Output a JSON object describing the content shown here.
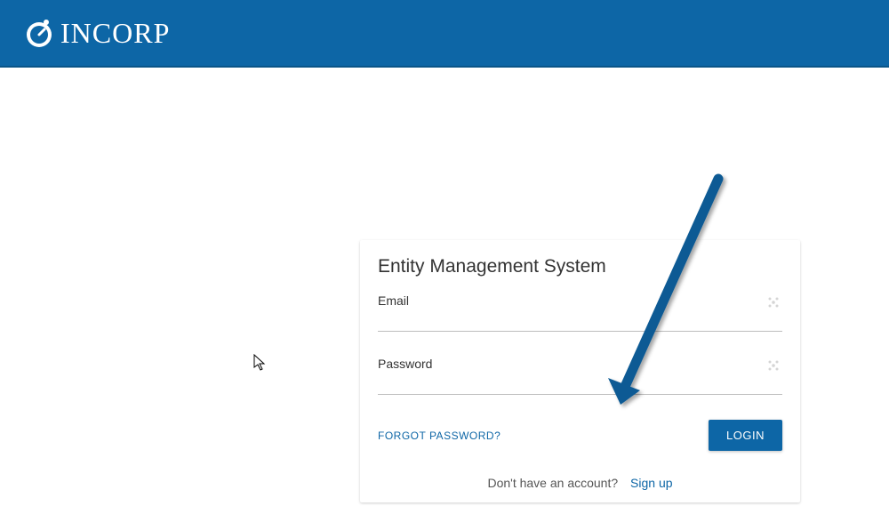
{
  "header": {
    "brand_name": "INCORP"
  },
  "login_card": {
    "title": "Entity Management System",
    "email": {
      "label": "Email",
      "value": ""
    },
    "password": {
      "label": "Password",
      "value": ""
    },
    "forgot_password_label": "FORGOT PASSWORD?",
    "login_button_label": "LOGIN",
    "signup_prompt": "Don't have an account?",
    "signup_link_label": "Sign up"
  },
  "colors": {
    "primary": "#0d66a6",
    "arrow": "#0a5a94"
  }
}
